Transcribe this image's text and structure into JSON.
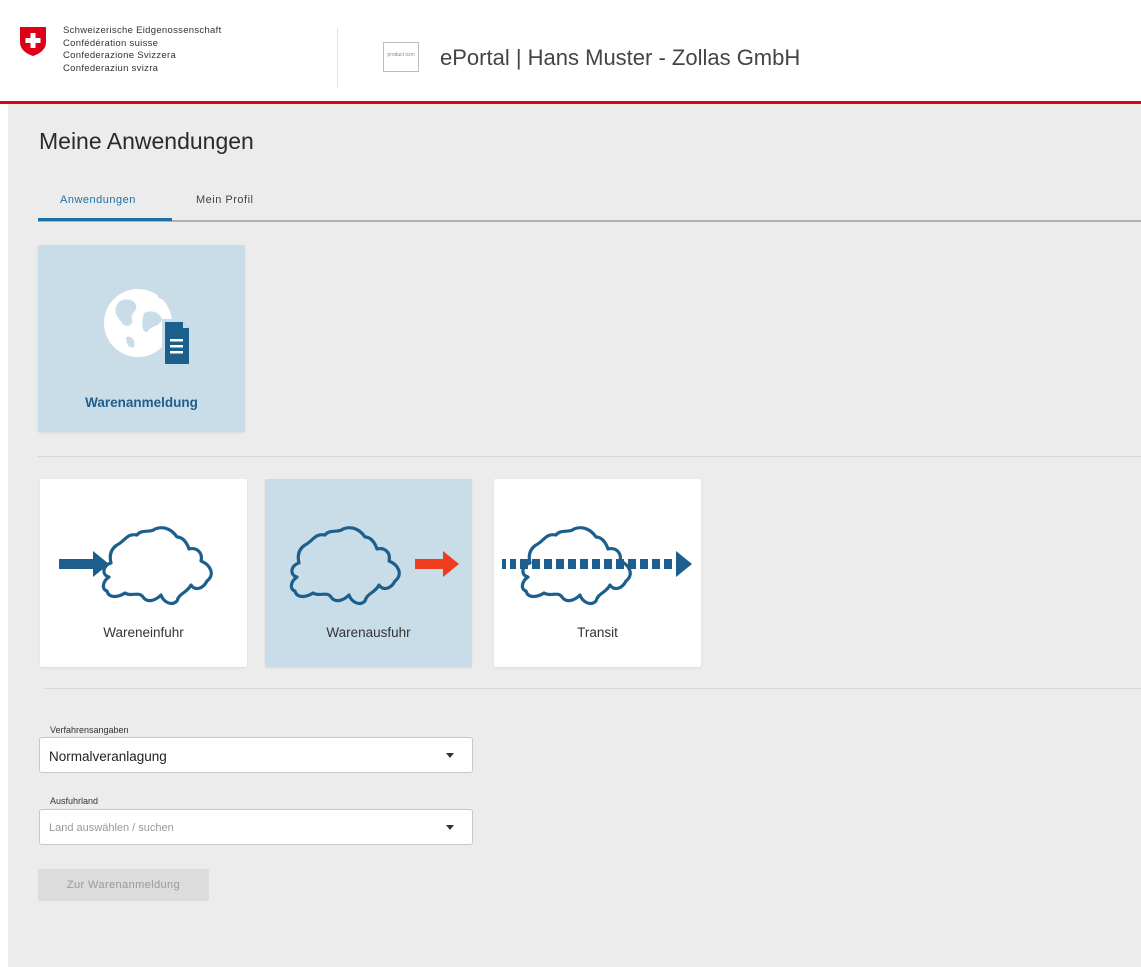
{
  "header": {
    "confederation": [
      "Schweizerische Eidgenossenschaft",
      "Confédération suisse",
      "Confederazione Svizzera",
      "Confederaziun svizra"
    ],
    "product_logo": "product icon",
    "portal_title": "ePortal | Hans Muster - Zollas GmbH"
  },
  "page": {
    "title": "Meine Anwendungen"
  },
  "tabs": [
    {
      "label": "Anwendungen",
      "active": true
    },
    {
      "label": "Mein Profil",
      "active": false
    }
  ],
  "applications": [
    {
      "label": "Warenanmeldung",
      "icon": "globe-document-icon",
      "selected": true
    }
  ],
  "procedures": [
    {
      "label": "Wareneinfuhr",
      "icon": "switzerland-import-icon",
      "selected": false
    },
    {
      "label": "Warenausfuhr",
      "icon": "switzerland-export-icon",
      "selected": true
    },
    {
      "label": "Transit",
      "icon": "switzerland-transit-icon",
      "selected": false
    }
  ],
  "form": {
    "procedure_label": "Verfahrensangaben",
    "procedure_value": "Normalveranlagung",
    "country_label": "Ausfuhrland",
    "country_placeholder": "Land auswählen / suchen",
    "submit_label": "Zur Warenanmeldung"
  },
  "colors": {
    "accent": "#1d6fa5",
    "swiss_red": "#dc0018",
    "export_arrow": "#f03c1e",
    "selected_card": "#c9dde9"
  }
}
